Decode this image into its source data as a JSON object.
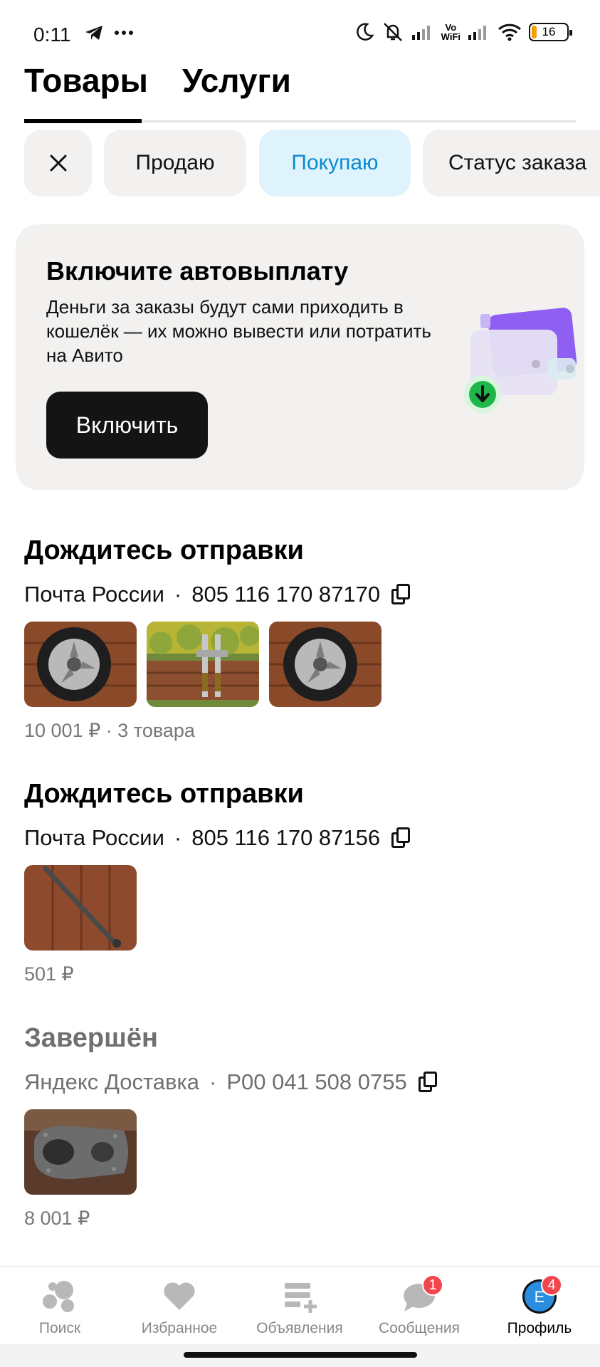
{
  "status_bar": {
    "time": "0:11",
    "vowifi_top": "Vo",
    "vowifi_bottom": "WiFi",
    "battery": "16"
  },
  "tabs": [
    {
      "label": "Товары",
      "active": true
    },
    {
      "label": "Услуги",
      "active": false
    }
  ],
  "filters": {
    "sell": "Продаю",
    "buy": "Покупаю",
    "status": "Статус заказа",
    "active_color": "#0a8bd0"
  },
  "banner": {
    "title": "Включите автовыплату",
    "text": "Деньги за заказы будут сами приходить в кошелёк — их можно вывести или потратить на Авито",
    "button": "Включить"
  },
  "orders": [
    {
      "status": "Дождитесь отправки",
      "carrier": "Почта России",
      "tracking": "805 116 170 87170",
      "summary": "10 001 ₽ · 3 товара",
      "thumbnails": [
        "wheel",
        "scooter-fork",
        "wheel"
      ]
    },
    {
      "status": "Дождитесь отправки",
      "carrier": "Почта России",
      "tracking": "805 116 170 87156",
      "summary": "501 ₽",
      "thumbnails": [
        "metal-rod"
      ]
    },
    {
      "status": "Завершён",
      "carrier": "Яндекс Доставка",
      "tracking": "P00 041 508 0755",
      "summary": "8 001 ₽",
      "thumbnails": [
        "engine-case"
      ]
    }
  ],
  "bottom_nav": [
    {
      "label": "Поиск",
      "icon": "search-icon",
      "badge": ""
    },
    {
      "label": "Избранное",
      "icon": "heart-icon",
      "badge": ""
    },
    {
      "label": "Объявления",
      "icon": "listings-icon",
      "badge": ""
    },
    {
      "label": "Сообщения",
      "icon": "messages-icon",
      "badge": "1"
    },
    {
      "label": "Профиль",
      "icon": "profile-avatar-icon",
      "badge": "4",
      "avatar_letter": "Е",
      "active": true
    }
  ],
  "colors": {
    "accent_blue": "#0a8bd0",
    "badge_red": "#f2454c",
    "button_dark": "#141414"
  }
}
